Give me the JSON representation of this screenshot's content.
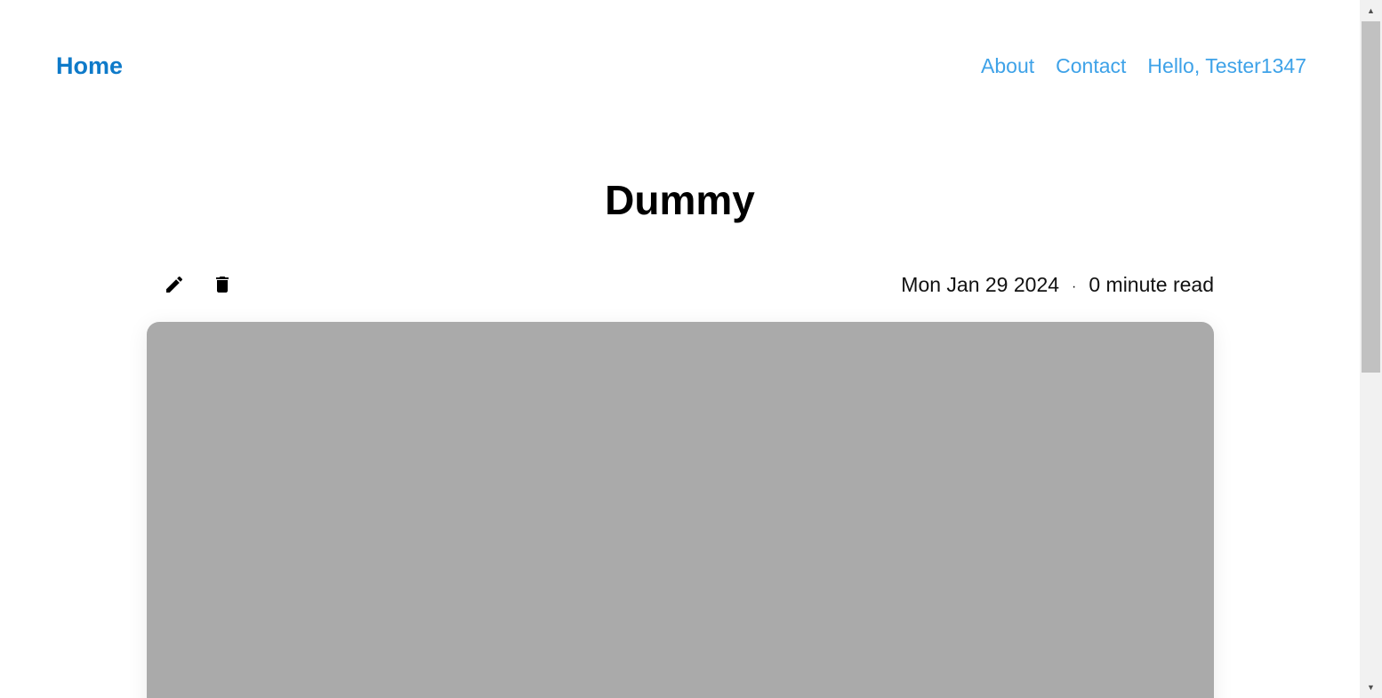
{
  "nav": {
    "brand": "Home",
    "links": [
      "About",
      "Contact",
      "Hello, Tester1347"
    ]
  },
  "post": {
    "title": "Dummy",
    "date": "Mon Jan 29 2024",
    "separator": "·",
    "read_time": "0 minute read",
    "actions": {
      "edit_icon": "pencil-icon",
      "delete_icon": "trash-icon"
    }
  },
  "colors": {
    "brand": "#0e7ac9",
    "link": "#3ea2e8",
    "image_placeholder": "#aaaaaa"
  },
  "scrollbar": {
    "up_arrow": "▲",
    "down_arrow": "▼"
  }
}
